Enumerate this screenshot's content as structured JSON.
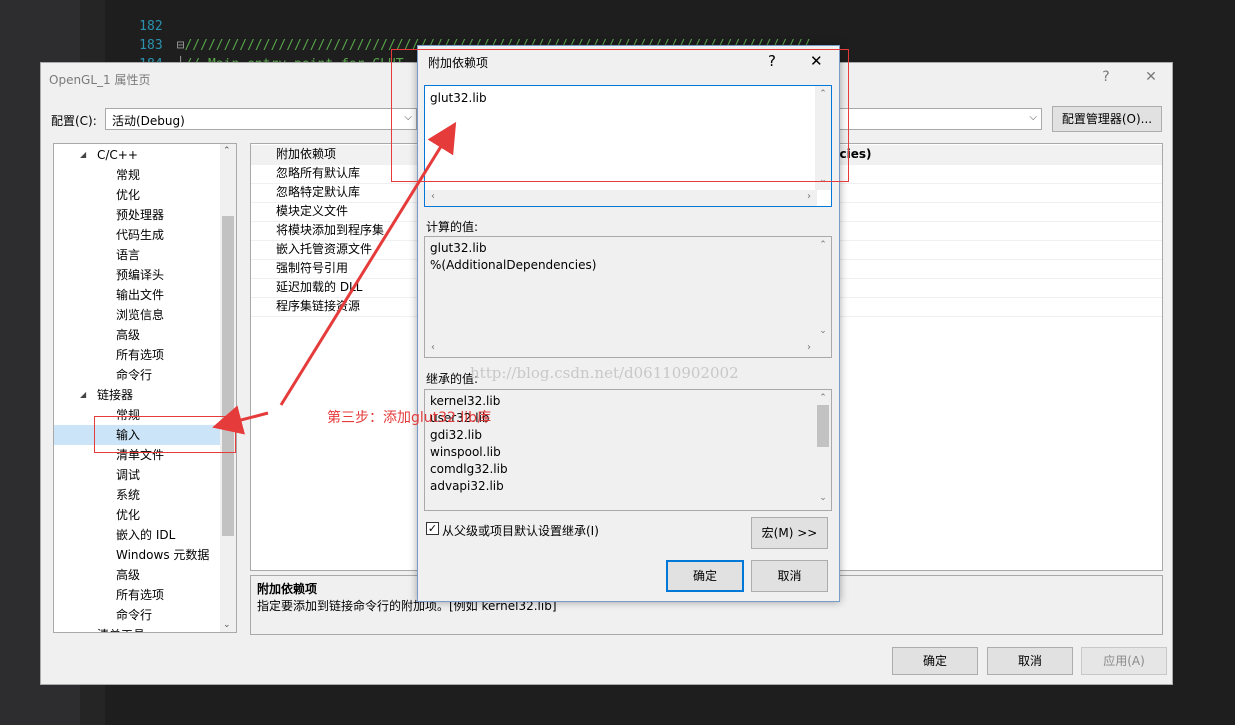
{
  "editor": {
    "lines": [
      {
        "num": "182",
        "text": ""
      },
      {
        "num": "183",
        "text": "////////////////////////////////////////////////////////////////////////////////"
      },
      {
        "num": "184",
        "text": "// Main entry point for GLUT"
      }
    ]
  },
  "main_dialog": {
    "title": "OpenGL_1 属性页",
    "help": "?",
    "close": "✕",
    "config_label": "配置(C):",
    "config_value": "活动(Debug)",
    "config_manager": "配置管理器(O)...",
    "tree": [
      {
        "label": "C/C++",
        "indent": 1,
        "expander": "◢"
      },
      {
        "label": "常规",
        "indent": 2
      },
      {
        "label": "优化",
        "indent": 2
      },
      {
        "label": "预处理器",
        "indent": 2
      },
      {
        "label": "代码生成",
        "indent": 2
      },
      {
        "label": "语言",
        "indent": 2
      },
      {
        "label": "预编译头",
        "indent": 2
      },
      {
        "label": "输出文件",
        "indent": 2
      },
      {
        "label": "浏览信息",
        "indent": 2
      },
      {
        "label": "高级",
        "indent": 2
      },
      {
        "label": "所有选项",
        "indent": 2
      },
      {
        "label": "命令行",
        "indent": 2
      },
      {
        "label": "链接器",
        "indent": 1,
        "expander": "◢"
      },
      {
        "label": "常规",
        "indent": 2
      },
      {
        "label": "输入",
        "indent": 2,
        "selected": true
      },
      {
        "label": "清单文件",
        "indent": 2
      },
      {
        "label": "调试",
        "indent": 2
      },
      {
        "label": "系统",
        "indent": 2
      },
      {
        "label": "优化",
        "indent": 2
      },
      {
        "label": "嵌入的 IDL",
        "indent": 2
      },
      {
        "label": "Windows 元数据",
        "indent": 2
      },
      {
        "label": "高级",
        "indent": 2
      },
      {
        "label": "所有选项",
        "indent": 2
      },
      {
        "label": "命令行",
        "indent": 2
      },
      {
        "label": "清单工具",
        "indent": 1,
        "expander": "▷"
      }
    ],
    "props": [
      {
        "name": "附加依赖项",
        "value": "ncies)"
      },
      {
        "name": "忽略所有默认库",
        "value": ""
      },
      {
        "name": "忽略特定默认库",
        "value": ""
      },
      {
        "name": "模块定义文件",
        "value": ""
      },
      {
        "name": "将模块添加到程序集",
        "value": ""
      },
      {
        "name": "嵌入托管资源文件",
        "value": ""
      },
      {
        "name": "强制符号引用",
        "value": ""
      },
      {
        "name": "延迟加载的 DLL",
        "value": ""
      },
      {
        "name": "程序集链接资源",
        "value": ""
      }
    ],
    "desc_title": "附加依赖项",
    "desc_text": "指定要添加到链接命令行的附加项。[例如 kernel32.lib]",
    "ok": "确定",
    "cancel": "取消",
    "apply": "应用(A)"
  },
  "sub_dialog": {
    "title": "附加依赖项",
    "help": "?",
    "close": "✕",
    "edit_value": "glut32.lib",
    "computed_label": "计算的值:",
    "computed": [
      "glut32.lib",
      "%(AdditionalDependencies)"
    ],
    "inherited_label": "继承的值:",
    "inherited": [
      "kernel32.lib",
      "user32.lib",
      "gdi32.lib",
      "winspool.lib",
      "comdlg32.lib",
      "advapi32.lib"
    ],
    "inherit_checkbox": "从父级或项目默认设置继承(I)",
    "inherit_checked": true,
    "macro": "宏(M) >>",
    "ok": "确定",
    "cancel": "取消"
  },
  "annotation": {
    "text": "第三步：添加glut32.lib库",
    "color": "#e53b3b"
  },
  "watermark": "http://blog.csdn.net/d06110902002"
}
